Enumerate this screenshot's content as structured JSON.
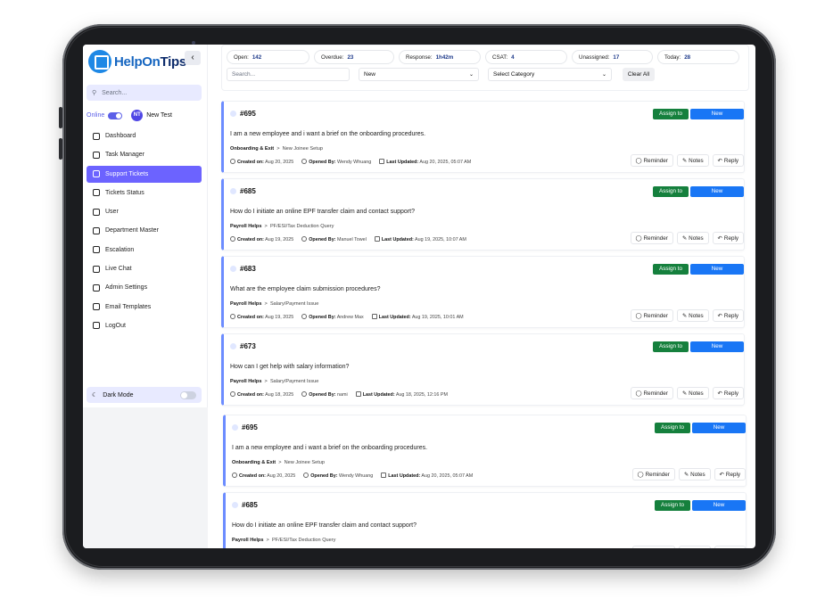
{
  "app": {
    "logo_part1": "HelpOn",
    "logo_part2": "Tips",
    "collapse_label": "‹"
  },
  "sidebar": {
    "search_placeholder": "Search...",
    "status_label": "Online",
    "user_initials": "NT",
    "user_name": "New Test",
    "items": [
      {
        "label": "Dashboard",
        "icon": "dashboard-icon",
        "active": false
      },
      {
        "label": "Task Manager",
        "icon": "task-icon",
        "active": false
      },
      {
        "label": "Support Tickets",
        "icon": "ticket-icon",
        "active": true
      },
      {
        "label": "Tickets Status",
        "icon": "ticket-status-icon",
        "active": false
      },
      {
        "label": "User",
        "icon": "users-icon",
        "active": false
      },
      {
        "label": "Department Master",
        "icon": "chart-icon",
        "active": false
      },
      {
        "label": "Escalation",
        "icon": "escalation-icon",
        "active": false
      },
      {
        "label": "Live Chat",
        "icon": "chat-icon",
        "active": false
      },
      {
        "label": "Admin Settings",
        "icon": "user-circle-icon",
        "active": false
      },
      {
        "label": "Email Templates",
        "icon": "at-icon",
        "active": false
      },
      {
        "label": "LogOut",
        "icon": "logout-icon",
        "active": false
      }
    ],
    "dark_mode_label": "Dark Mode"
  },
  "stats": [
    {
      "label": "Open:",
      "value": "142"
    },
    {
      "label": "Overdue:",
      "value": "23"
    },
    {
      "label": "Response:",
      "value": "1h42m"
    },
    {
      "label": "CSAT:",
      "value": "4"
    },
    {
      "label": "Unassigned:",
      "value": "17"
    },
    {
      "label": "Today:",
      "value": "28"
    }
  ],
  "filters": {
    "search_placeholder": "Search...",
    "status_value": "New",
    "category_value": "Select Category",
    "clear_label": "Clear All"
  },
  "ticket_labels": {
    "assign": "Assign to",
    "status": "New",
    "created": "Created on:",
    "opened": "Opened By:",
    "updated": "Last Updated:",
    "reminder": "Reminder",
    "notes": "Notes",
    "reply": "Reply"
  },
  "tickets": [
    {
      "id": "#695",
      "title": "I am a new employee and i want a brief on the onboarding procedures.",
      "category": "Onboarding & Exit",
      "subcategory": "New Joinee Setup",
      "created": "Aug 20, 2025",
      "opened_by": "Wendy Whuang",
      "updated": "Aug 20, 2025, 05:07 AM"
    },
    {
      "id": "#685",
      "title": "How do I initiate an online EPF transfer claim and contact support?",
      "category": "Payroll Helps",
      "subcategory": "PF/ESI/Tax Deduction Query",
      "created": "Aug 19, 2025",
      "opened_by": "Manuel Towel",
      "updated": "Aug 19, 2025, 10:07 AM"
    },
    {
      "id": "#683",
      "title": "What are the employee claim submission procedures?",
      "category": "Payroll Helps",
      "subcategory": "Salary/Payment Issue",
      "created": "Aug 19, 2025",
      "opened_by": "Andrew Max",
      "updated": "Aug 19, 2025, 10:01 AM"
    },
    {
      "id": "#673",
      "title": "How can I get help with salary information?",
      "category": "Payroll Helps",
      "subcategory": "Salary/Payment Issue",
      "created": "Aug 18, 2025",
      "opened_by": "nami",
      "updated": "Aug 18, 2025, 12:16 PM"
    },
    {
      "id": "#695",
      "title": "I am a new employee and i want a brief on the onboarding procedures.",
      "category": "Onboarding & Exit",
      "subcategory": "New Joinee Setup",
      "created": "Aug 20, 2025",
      "opened_by": "Wendy Whuang",
      "updated": "Aug 20, 2025, 05:07 AM"
    },
    {
      "id": "#685",
      "title": "How do I initiate an online EPF transfer claim and contact support?",
      "category": "Payroll Helps",
      "subcategory": "PF/ESI/Tax Deduction Query",
      "created": "",
      "opened_by": "",
      "updated": ""
    }
  ],
  "colors": {
    "accent": "#6c63ff",
    "assign": "#15803d",
    "status_new": "#1976f5"
  }
}
